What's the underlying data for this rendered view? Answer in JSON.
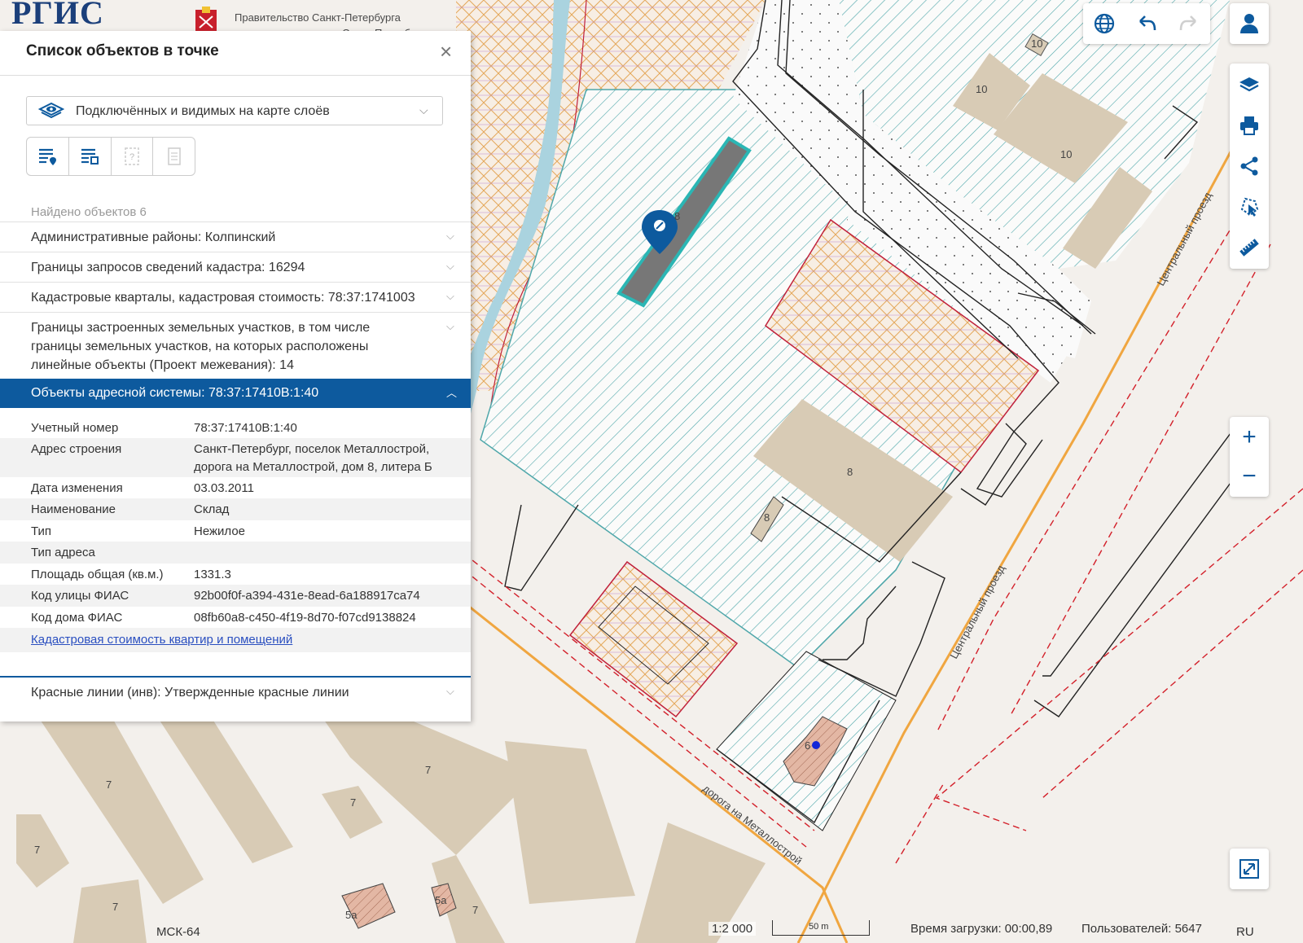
{
  "header": {
    "logo_text": "РГИС",
    "gov_text": "Правительство Санкт-Петербурга",
    "gov_subtext": "Санкт-Петербурга"
  },
  "panel": {
    "title": "Список объектов в точке",
    "close_glyph": "×",
    "layer_select": {
      "value": "Подключённых и видимых на карте слоёв",
      "icon": "layers-eye-icon"
    },
    "tools": [
      {
        "name": "list-point-icon"
      },
      {
        "name": "list-area-icon"
      },
      {
        "name": "info-help-icon"
      },
      {
        "name": "document-icon"
      }
    ],
    "found_text": "Найдено объектов 6",
    "layers": [
      {
        "label": "Административные районы: Колпинский"
      },
      {
        "label": "Границы запросов сведений кадастра: 16294"
      },
      {
        "label": "Кадастровые кварталы, кадастровая стоимость: 78:37:1741003"
      },
      {
        "label_lines": [
          "Границы застроенных земельных участков, в том числе",
          "границы земельных участков, на которых расположены",
          "линейные объекты (Проект межевания): 14"
        ]
      },
      {
        "label": "Объекты адресной системы: 78:37:17410В:1:40",
        "active": true
      },
      {
        "label": "Красные линии (инв): Утвержденные красные линии"
      }
    ],
    "attributes": [
      {
        "key": "Учетный номер",
        "value": "78:37:17410В:1:40"
      },
      {
        "key": "Адрес строения",
        "value_lines": [
          "Санкт-Петербург, поселок Металлострой,",
          "дорога на Металлострой, дом 8, литера Б"
        ]
      },
      {
        "key": "Дата изменения",
        "value": "03.03.2011"
      },
      {
        "key": "Наименование",
        "value": "Склад"
      },
      {
        "key": "Тип",
        "value": "Нежилое"
      },
      {
        "key": "Тип адреса",
        "value": ""
      },
      {
        "key": "Площадь общая (кв.м.)",
        "value": "1331.3"
      },
      {
        "key": "Код улицы ФИАС",
        "value": "92b00f0f-a394-431e-8ead-6a188917ca74"
      },
      {
        "key": "Код дома ФИАС",
        "value": "08fb60a8-c450-4f19-8d70-f07cd9138824"
      }
    ],
    "link_text": "Кадастровая стоимость квартир и помещений"
  },
  "toolbar_top": [
    {
      "name": "globe-icon"
    },
    {
      "name": "undo-icon"
    },
    {
      "name": "redo-icon"
    }
  ],
  "toolbar_user": {
    "name": "user-icon"
  },
  "toolbar_right": [
    {
      "name": "layers-icon"
    },
    {
      "name": "print-icon"
    },
    {
      "name": "share-icon"
    },
    {
      "name": "select-area-icon"
    },
    {
      "name": "ruler-icon"
    }
  ],
  "zoom": {
    "in_glyph": "+",
    "out_glyph": "−"
  },
  "fullscreen": {
    "name": "expand-icon"
  },
  "map_labels": {
    "street_1": "Центральный проезд",
    "street_2": "Центральный проезд",
    "street_3": "дорога на Металлострой",
    "n10a": "10",
    "n10b": "10",
    "n10c": "10",
    "n8a": "8",
    "n8b": "8",
    "n8c": "8",
    "n6": "6",
    "n7a": "7",
    "n7b": "7",
    "n7c": "7",
    "n7d": "7",
    "n7e": "7",
    "n7f": "7",
    "n5a": "5а",
    "n5b": "5а"
  },
  "status_bar": {
    "crs": "МСК-64",
    "scale": "1:2 000",
    "scale_bar_label": "50 m",
    "load_time": "Время загрузки: 00:00,89",
    "users": "Пользователей: 5647",
    "lang": "RU"
  },
  "colors": {
    "accent": "#0d5a9e",
    "hatch_teal": "#4fa7aa",
    "hatch_orange": "#e4a85a",
    "building": "#d8cbb5",
    "road_orange": "#f0a640",
    "red_line": "#d3202a"
  }
}
